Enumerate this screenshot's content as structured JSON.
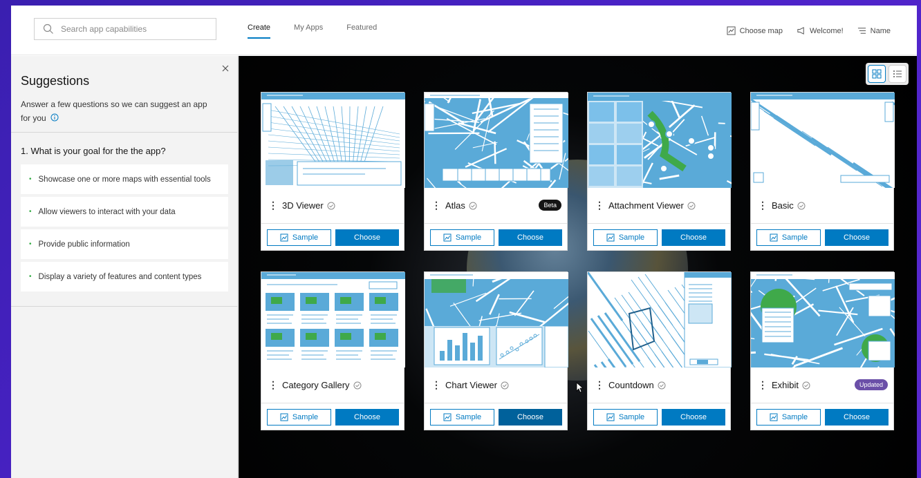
{
  "header": {
    "search_placeholder": "Search app capabilities",
    "tabs": [
      {
        "label": "Create",
        "active": true
      },
      {
        "label": "My Apps",
        "active": false
      },
      {
        "label": "Featured",
        "active": false
      }
    ],
    "right_buttons": {
      "choose_map": "Choose map",
      "welcome": "Welcome!",
      "sort": "Name"
    }
  },
  "sidebar": {
    "title": "Suggestions",
    "description": "Answer a few questions so we can suggest an app for you",
    "question": "1. What is your goal for the the app?",
    "options": [
      "Showcase one or more maps with essential tools",
      "Allow viewers to interact with your data",
      "Provide public information",
      "Display a variety of features and content types"
    ]
  },
  "gallery": {
    "sample_label": "Sample",
    "choose_label": "Choose",
    "cards": [
      {
        "title": "3D Viewer",
        "badge": "",
        "thumb": "viewer3d"
      },
      {
        "title": "Atlas",
        "badge": "Beta",
        "thumb": "atlas"
      },
      {
        "title": "Attachment Viewer",
        "badge": "",
        "thumb": "attachment"
      },
      {
        "title": "Basic",
        "badge": "",
        "thumb": "basic"
      },
      {
        "title": "Category Gallery",
        "badge": "",
        "thumb": "category"
      },
      {
        "title": "Chart Viewer",
        "badge": "",
        "thumb": "chart"
      },
      {
        "title": "Countdown",
        "badge": "",
        "thumb": "countdown"
      },
      {
        "title": "Exhibit",
        "badge": "Updated",
        "thumb": "exhibit"
      }
    ]
  },
  "colors": {
    "accent": "#007ac2",
    "map_blue": "#5aaad8",
    "map_green": "#3fa94a",
    "updated_badge": "#6b4fa8"
  },
  "icons": [
    "search-icon",
    "map-icon",
    "megaphone-icon",
    "sort-icon",
    "close-icon",
    "info-icon",
    "grid-view-icon",
    "list-view-icon",
    "kebab-icon",
    "circle-check-icon",
    "sample-map-icon"
  ]
}
